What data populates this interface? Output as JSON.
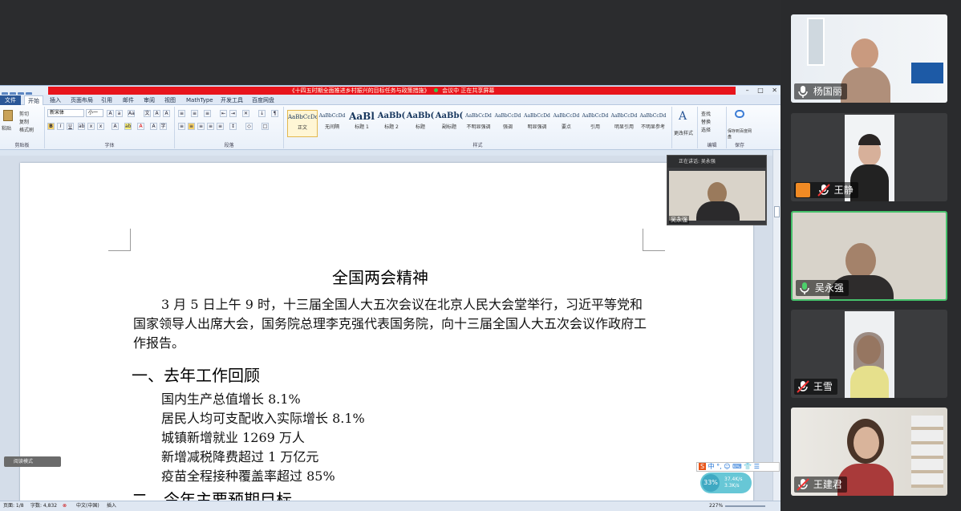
{
  "word": {
    "window_title": "《十四五时期全面推进乡村振兴的目标任务与政策措施》",
    "share_bar_text": "正在共享屏幕",
    "share_status": "会议中",
    "win_controls": [
      "–",
      "□",
      "✕"
    ],
    "tabs": [
      "文件",
      "开始",
      "插入",
      "页面布局",
      "引用",
      "邮件",
      "审阅",
      "视图",
      "MathType",
      "开发工具",
      "百度网盘"
    ],
    "clipboard": {
      "paste": "粘贴",
      "cut": "剪切",
      "copy": "复制",
      "format_painter": "格式刷",
      "group": "剪贴板"
    },
    "font": {
      "name": "新宋体",
      "size": "小一",
      "group": "字体"
    },
    "paragraph_group": "段落",
    "styles": [
      {
        "sample": "AaBbCcDd",
        "name": "正文"
      },
      {
        "sample": "AaBbCcDd",
        "name": "无间隔"
      },
      {
        "sample": "AaBl",
        "name": "标题 1"
      },
      {
        "sample": "AaBb(",
        "name": "标题 2"
      },
      {
        "sample": "AaBb(",
        "name": "标题"
      },
      {
        "sample": "AaBb(",
        "name": "副标题"
      },
      {
        "sample": "AaBbCcDd",
        "name": "不明显强调"
      },
      {
        "sample": "AaBbCcDd",
        "name": "强调"
      },
      {
        "sample": "AaBbCcDd",
        "name": "明显强调"
      },
      {
        "sample": "AaBbCcDd",
        "name": "要点"
      },
      {
        "sample": "AaBbCcDd",
        "name": "引用"
      },
      {
        "sample": "AaBbCcDd",
        "name": "明显引用"
      },
      {
        "sample": "AaBbCcDd",
        "name": "不明显参考"
      }
    ],
    "styles_group": "样式",
    "change_styles": "更改样式",
    "edit": {
      "find": "查找",
      "replace": "替换",
      "select": "选择",
      "group": "编辑"
    },
    "save": {
      "label": "保存到百度网盘",
      "group": "保存"
    }
  },
  "document": {
    "title": "全国两会精神",
    "paragraph": "3 月 5 日上午 9 时，十三届全国人大五次会议在北京人民大会堂举行，习近平等党和国家领导人出席大会，国务院总理李克强代表国务院，向十三届全国人大五次会议作政府工作报告。",
    "heading1": "一、去年工作回顾",
    "list": [
      "国内生产总值增长 8.1%",
      "居民人均可支配收入实际增长 8.1%",
      "城镇新增就业 1269 万人",
      "新增减税降费超过 1 万亿元",
      "疫苗全程接种覆盖率超过 85%"
    ],
    "heading2": "二、今年主要预期目标"
  },
  "status": {
    "page": "页面: 1/8",
    "words": "字数: 4,832",
    "lang": "中文(中国)",
    "insert": "插入",
    "zoom": "227%"
  },
  "pip": {
    "speaking": "正在讲话: 吴永强",
    "name": "吴永强"
  },
  "reader": "阅读模式",
  "ime": {
    "lang": "中",
    "extra": "°, ☺ ⌨ 👕 ☰"
  },
  "net": {
    "pct": "33%",
    "up": "37.4K/s",
    "down": "3.3K/s"
  },
  "participants": [
    {
      "name": "杨国丽",
      "mic": "on",
      "host": false
    },
    {
      "name": "王静",
      "mic": "muted",
      "host": true
    },
    {
      "name": "吴永强",
      "mic": "on-green",
      "host": false,
      "active": true
    },
    {
      "name": "王雪",
      "mic": "muted",
      "host": false
    },
    {
      "name": "王建君",
      "mic": "muted",
      "host": false
    }
  ]
}
